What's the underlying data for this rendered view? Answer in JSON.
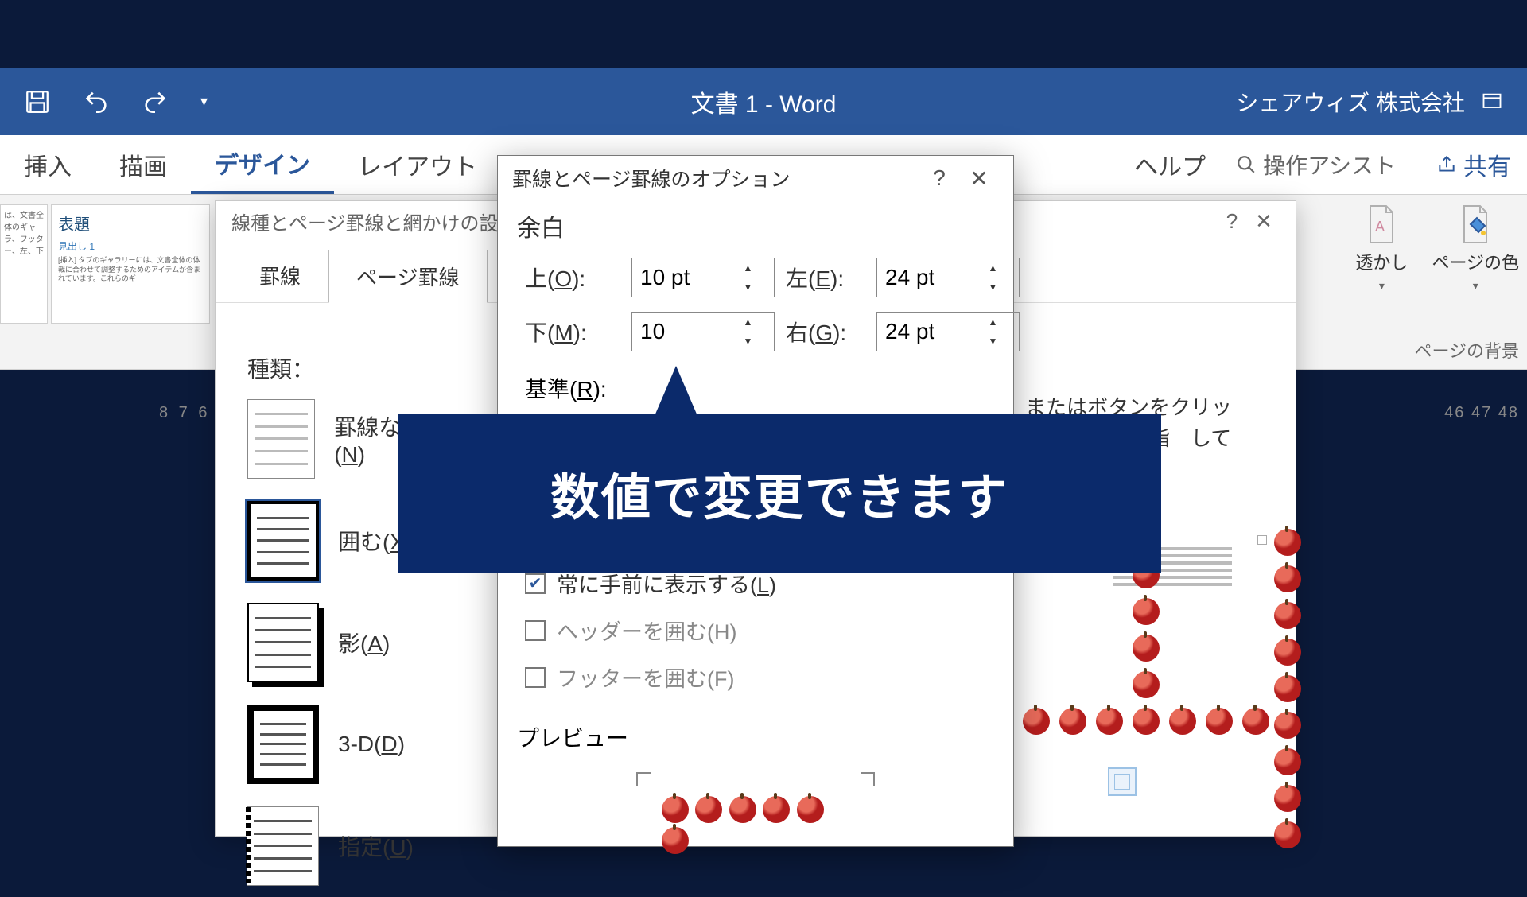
{
  "titlebar": {
    "doc_title": "文書 1  -  Word",
    "account": "シェアウィズ 株式会社"
  },
  "ribbon": {
    "tabs": [
      "挿入",
      "描画",
      "デザイン",
      "レイアウト"
    ],
    "active_index": 2,
    "help": "ヘルプ",
    "tell_me": "操作アシスト",
    "share": "共有",
    "right_buttons": {
      "watermark": "透かし",
      "page_color": "ページの色"
    },
    "group_label": "ページの背景",
    "gallery": {
      "title": "表題",
      "heading": "見出し 1",
      "body": "[挿入] タブのギャラリーには、文書全体の体裁に合わせて調整するためのアイテムが含まれています。これらのギ"
    }
  },
  "ruler_left": "8 7 6",
  "ruler_right": "46 47 48",
  "parent_dialog": {
    "title": "線種とページ罫線と網かけの設",
    "tabs": [
      "罫線",
      "ページ罫線"
    ],
    "active_tab": 1,
    "kind_label": "種類：",
    "kinds": [
      "罫線なし(N)",
      "囲む(X)",
      "影(A)",
      "3-D(D)",
      "指定(U)"
    ],
    "right_text": "またはボタンをクリック　　位置　指　してく"
  },
  "opts_dialog": {
    "title": "罫線とページ罫線のオプション",
    "section_margin": "余白",
    "top_label": "上(O):",
    "bottom_label": "下(M):",
    "left_label": "左(E):",
    "right_label": "右(G):",
    "top_val": "10 pt",
    "bottom_val": "10",
    "left_val": "24 pt",
    "right_val": "24 pt",
    "basis_label": "基準(R):",
    "chk_front": "常に手前に表示する(L)",
    "chk_header": "ヘッダーを囲む(H)",
    "chk_footer": "フッターを囲む(F)",
    "preview_label": "プレビュー"
  },
  "annotation": "数値で変更できます"
}
